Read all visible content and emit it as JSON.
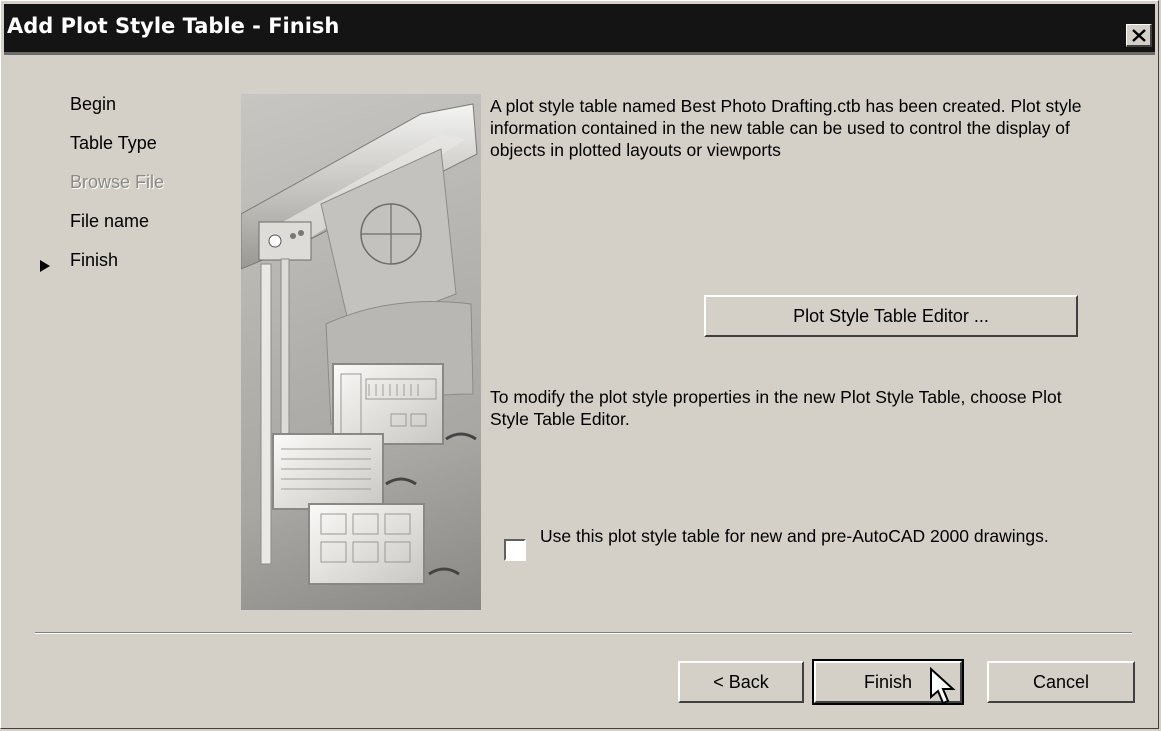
{
  "window": {
    "title": "Add Plot Style Table - Finish",
    "close_icon": "close-x-icon"
  },
  "steps": [
    {
      "label": "Begin",
      "enabled": true,
      "current": false
    },
    {
      "label": "Table Type",
      "enabled": true,
      "current": false
    },
    {
      "label": "Browse File",
      "enabled": false,
      "current": false
    },
    {
      "label": "File name",
      "enabled": true,
      "current": false
    },
    {
      "label": "Finish",
      "enabled": true,
      "current": true
    }
  ],
  "content": {
    "created_message": "A plot style table named Best Photo Drafting.ctb has been created. Plot style information contained in the new table can be used to control the display of objects in plotted layouts or viewports",
    "editor_button_label": "Plot Style Table Editor ...",
    "modify_message": "To modify the plot style properties in the new Plot Style Table, choose Plot Style Table Editor.",
    "checkbox": {
      "label": "Use this plot style table for new and pre-AutoCAD 2000 drawings.",
      "checked": false
    }
  },
  "footer": {
    "back_label": "< Back",
    "finish_label": "Finish",
    "cancel_label": "Cancel"
  },
  "icons": [
    "close-x-icon",
    "current-step-arrow-icon",
    "plotter-illustration",
    "mouse-pointer-icon"
  ]
}
